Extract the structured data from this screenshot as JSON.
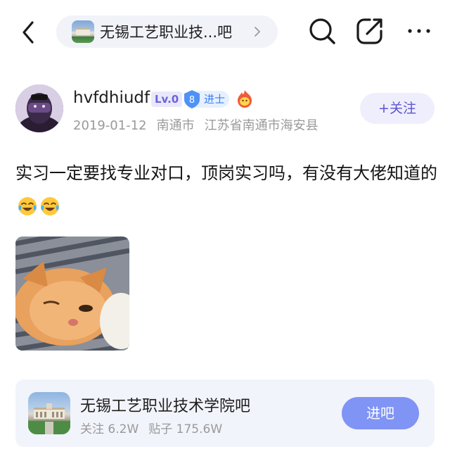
{
  "topbar": {
    "back_icon": "chevron-left-icon",
    "forum_title": "无锡工艺职业技...吧",
    "search_icon": "search-icon",
    "share_icon": "share-icon",
    "more_icon": "more-icon"
  },
  "post": {
    "username": "hvfdhiudf",
    "level_badge": "Lv.0",
    "rank_number": "8",
    "rank_title": "进士",
    "date": "2019-01-12",
    "location_city": "南通市",
    "location_full": "江苏省南通市海安县",
    "follow_label": "+关注",
    "text": "实习一定要找专业对口，顶岗实习吗，有没有大佬知道的",
    "emoji": "tears-of-joy-emoji"
  },
  "forum_card": {
    "name": "无锡工艺职业技术学院吧",
    "followers": "关注 6.2W",
    "posts": "贴子 175.6W",
    "enter_label": "进吧"
  },
  "colors": {
    "accent": "#5b54d6",
    "enter_button": "#8094f5",
    "muted_text": "#9a9a9a",
    "card_bg": "#f2f4fb"
  }
}
